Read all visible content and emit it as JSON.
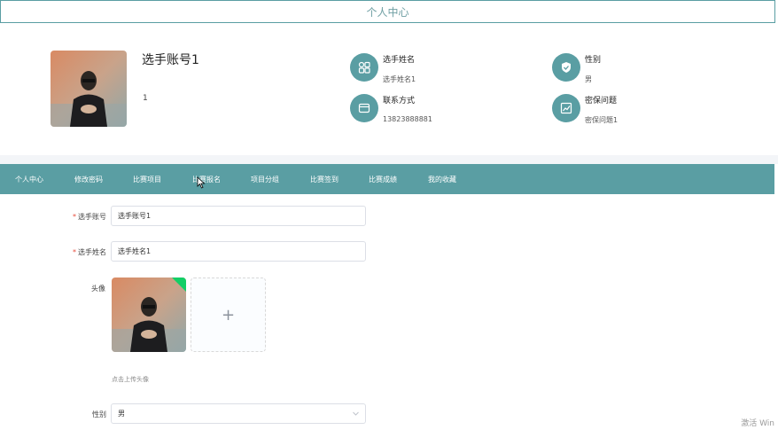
{
  "header": {
    "title": "个人中心"
  },
  "profile": {
    "username": "选手账号1",
    "id_value": "1",
    "fields": [
      {
        "label": "选手姓名",
        "value": "选手姓名1",
        "icon": "grid-icon"
      },
      {
        "label": "性别",
        "value": "男",
        "icon": "shield-check-icon"
      },
      {
        "label": "联系方式",
        "value": "13823888881",
        "icon": "card-icon"
      },
      {
        "label": "密保问题",
        "value": "密保问题1",
        "icon": "chart-icon"
      }
    ]
  },
  "nav": {
    "items": [
      "个人中心",
      "修改密码",
      "比赛项目",
      "比赛报名",
      "项目分组",
      "比赛签到",
      "比赛成绩",
      "我的收藏"
    ]
  },
  "form": {
    "account_label": "选手账号",
    "account_value": "选手账号1",
    "name_label": "选手姓名",
    "name_value": "选手姓名1",
    "avatar_label": "头像",
    "upload_hint": "点击上传头像",
    "gender_label": "性别",
    "gender_value": "男"
  },
  "colors": {
    "accent": "#5a9ea3",
    "required": "#e74c3c",
    "success": "#13ce66"
  },
  "watermark": "激活 Win"
}
